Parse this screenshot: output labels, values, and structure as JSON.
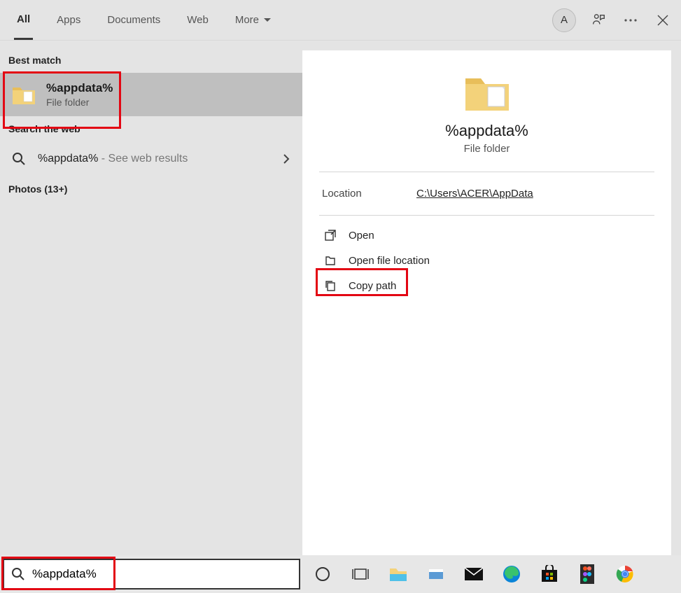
{
  "tabs": {
    "all": "All",
    "apps": "Apps",
    "documents": "Documents",
    "web": "Web",
    "more": "More"
  },
  "avatar_letter": "A",
  "best_match_header": "Best match",
  "best_match": {
    "title": "%appdata%",
    "subtitle": "File folder"
  },
  "search_web_header": "Search the web",
  "web_result": {
    "term": "%appdata%",
    "suffix": " - See web results"
  },
  "photos_header": "Photos (13+)",
  "preview": {
    "title": "%appdata%",
    "subtitle": "File folder",
    "location_label": "Location",
    "location_value": "C:\\Users\\ACER\\AppData"
  },
  "actions": {
    "open": "Open",
    "open_location": "Open file location",
    "copy_path": "Copy path"
  },
  "search_input_value": "%appdata%"
}
